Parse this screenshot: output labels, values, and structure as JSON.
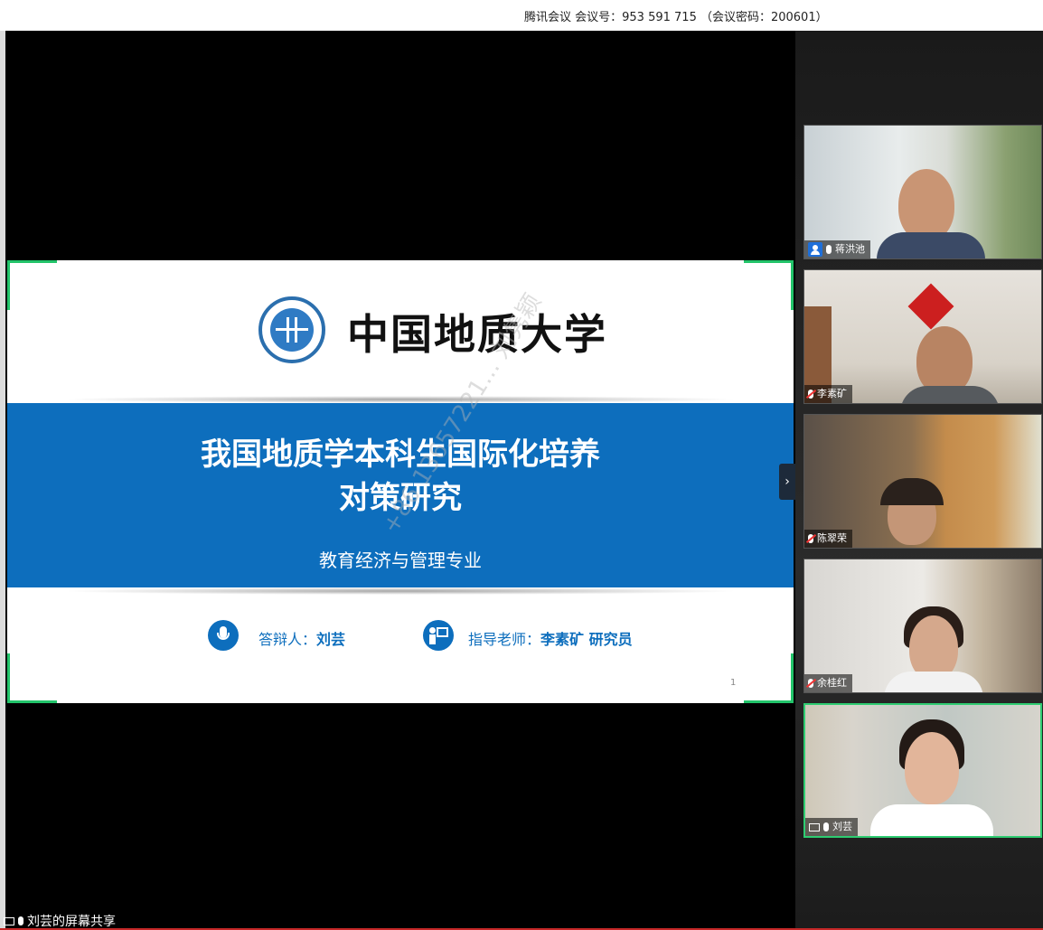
{
  "window": {
    "title": "腾讯会议  会议号：953 591 715  （会议密码：200601）"
  },
  "slide": {
    "university_name": "中国地质大学",
    "title_line1": "我国地质学本科生国际化培养",
    "title_line2": "对策研究",
    "subtitle": "教育经济与管理专业",
    "defender_label": "答辩人：",
    "defender_name": "刘芸",
    "advisor_label": "指导老师：",
    "advisor_name": "李素矿  研究员",
    "page_number": "1",
    "watermark": "+86 13657221... 刘隽颖",
    "accent_color": "#0d6ebd"
  },
  "participants": [
    {
      "name": "蒋洪池",
      "mic": "on",
      "icon": "user-icon"
    },
    {
      "name": "李素矿",
      "mic": "muted",
      "icon": "mic-icon"
    },
    {
      "name": "陈翠荣",
      "mic": "muted",
      "icon": "mic-icon"
    },
    {
      "name": "余桂红",
      "mic": "muted",
      "icon": "mic-icon"
    },
    {
      "name": "刘芸",
      "mic": "on",
      "icon": "screen-share-icon",
      "active": true
    }
  ],
  "status": {
    "share_text": "刘芸的屏幕共享"
  },
  "colors": {
    "active_border": "#2ecc71",
    "corner_marker": "#22c46a"
  }
}
